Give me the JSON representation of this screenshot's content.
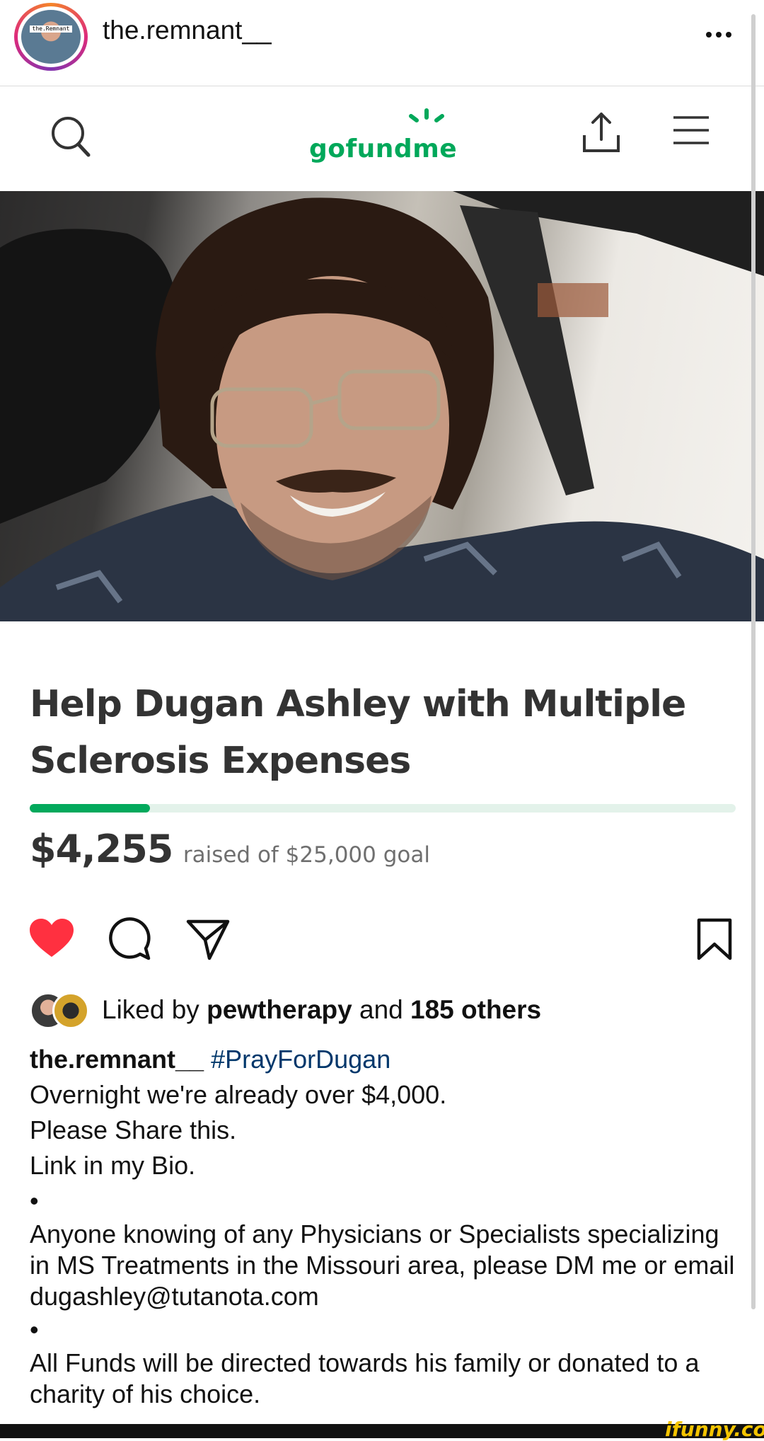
{
  "instagram": {
    "username": "the.remnant__",
    "avatar_tag": "the.Remnant",
    "more_icon": "more-horizontal-icon"
  },
  "gofundme": {
    "logo_text": "gofundme",
    "search_icon": "search-icon",
    "share_icon": "share-upload-icon",
    "menu_icon": "hamburger-menu-icon",
    "brand_color": "#02a95c"
  },
  "campaign": {
    "title_line1": "Help Dugan Ashley with Multiple",
    "title_line2": "Sclerosis Expenses",
    "raised": "$4,255",
    "goal_text": "raised of $25,000 goal",
    "progress_fraction": 0.17
  },
  "actions": {
    "like_icon": "heart-filled-icon",
    "comment_icon": "comment-icon",
    "send_icon": "send-icon",
    "save_icon": "bookmark-icon",
    "like_color": "#ff3040"
  },
  "likes": {
    "prefix": "Liked by",
    "user": "pewtherapy",
    "and": "and",
    "others": "185 others"
  },
  "caption": {
    "username": "the.remnant__",
    "hashtag": "#PrayForDugan",
    "line1": "Overnight we're already over $4,000.",
    "line2": "Please Share this.",
    "line3": "Link in my Bio.",
    "bullet": "•",
    "para2": "Anyone knowing of any Physicians or Specialists specializing in MS Treatments in the Missouri area, please DM me or email dugashley@tutanota.com",
    "para3": "All Funds will be directed towards his family or donated to a charity of his choice."
  },
  "watermark": "ifunny.co"
}
